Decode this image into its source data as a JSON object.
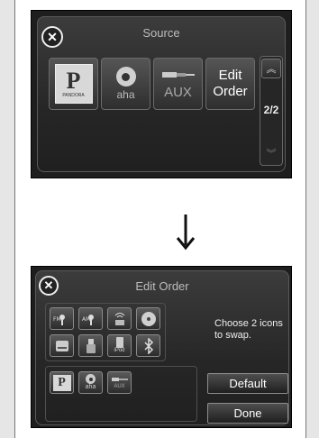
{
  "top_screen": {
    "title": "Source",
    "close_icon": "close-icon",
    "tiles": [
      {
        "icon": "pandora-icon",
        "text": "P",
        "caption": "PANDORA"
      },
      {
        "icon": "aha-icon",
        "caption": "aha"
      },
      {
        "icon": "aux-icon",
        "caption": "AUX"
      },
      {
        "line1": "Edit",
        "line2": "Order"
      }
    ],
    "scroll": {
      "page": "2/2",
      "up_icon": "double-chevron-up-icon",
      "down_icon": "double-chevron-down-icon"
    }
  },
  "arrow_icon": "arrow-down-icon",
  "bottom_screen": {
    "title": "Edit Order",
    "close_icon": "close-icon",
    "grid_icons": [
      "fm-radio-icon",
      "am-radio-icon",
      "xm-radio-icon",
      "disc-icon",
      "hdd-icon",
      "usb-icon",
      "ipod-icon",
      "bluetooth-icon"
    ],
    "ipod_caption": "iPod",
    "row3_icons": [
      {
        "icon": "pandora-icon",
        "text": "P"
      },
      {
        "icon": "aha-icon",
        "caption": "aha"
      },
      {
        "icon": "aux-icon",
        "caption": "AUX"
      }
    ],
    "hint": "Choose 2 icons to swap.",
    "default_label": "Default",
    "done_label": "Done"
  }
}
